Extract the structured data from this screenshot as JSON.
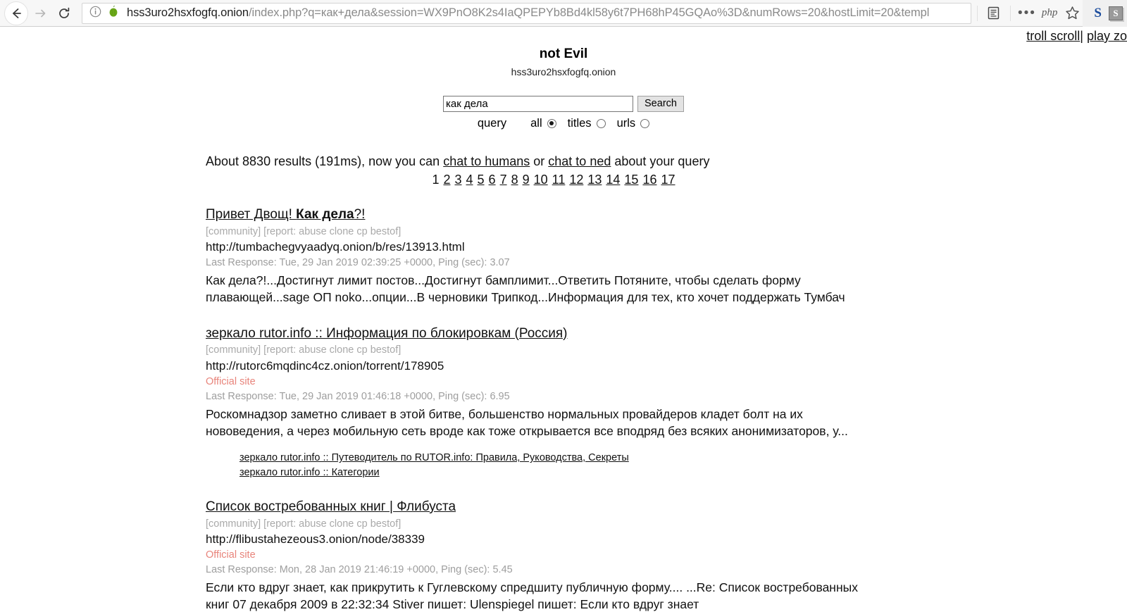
{
  "browser": {
    "url_host": "hss3uro2hsxfogfq.onion",
    "url_path": "/index.php?q=как+дела&session=WX9PnO8K2s4IaQPEPYb8Bd4kl58y6t7PH68hP45GQAo%3D&numRows=20&hostLimit=20&templ",
    "back_icon": "back-arrow-icon",
    "forward_icon": "forward-arrow-icon",
    "reload_icon": "reload-icon",
    "info_icon": "info-icon",
    "onion_icon": "onion-icon",
    "reader_icon": "reader-mode-icon",
    "menu_dots": "•••",
    "php_badge": "php",
    "star_icon": "bookmark-star-icon",
    "ext_s_blue": "S",
    "ext_s_gray": "S"
  },
  "top_links": {
    "troll_scroll": "troll scroll",
    "separator": "|",
    "play_zo": "play zo"
  },
  "site": {
    "title": "not Evil",
    "domain": "hss3uro2hsxfogfq.onion"
  },
  "search": {
    "value": "как дела",
    "button_label": "Search",
    "query_label": "query",
    "options": [
      {
        "label": "all",
        "checked": true
      },
      {
        "label": "titles",
        "checked": false
      },
      {
        "label": "urls",
        "checked": false
      }
    ]
  },
  "summary": {
    "prefix": "About 8830 results (191ms), now you can ",
    "link1": "chat to humans",
    "middle": " or ",
    "link2": "chat to ned",
    "suffix": " about your query",
    "result_count": 8830,
    "time_ms": 191
  },
  "pagination": {
    "current": "1",
    "pages": [
      "2",
      "3",
      "4",
      "5",
      "6",
      "7",
      "8",
      "9",
      "10",
      "11",
      "12",
      "13",
      "14",
      "15",
      "16",
      "17"
    ]
  },
  "results": [
    {
      "title_plain1": "Привет Двощ! ",
      "title_bold": "Как дела",
      "title_plain2": "?!",
      "tags": "[community] [report: abuse clone cp bestof]",
      "url": "http://tumbachegvyaadyq.onion/b/res/13913.html",
      "official": null,
      "meta": "Last Response: Tue, 29 Jan 2019 02:39:25 +0000, Ping (sec): 3.07",
      "snippet": "Как дела?!...Достигнут лимит постов...Достигнут бамплимит...Ответить Потяните, чтобы сделать форму плавающей...sage ОП noko...опции...В черновики Трипкод...Информация для тех, кто хочет поддержать Тумбач",
      "sublinks": []
    },
    {
      "title_plain1": "зеркало rutor.info :: Информация по блокировкам (Россия)",
      "title_bold": "",
      "title_plain2": "",
      "tags": "[community] [report: abuse clone cp bestof]",
      "url": "http://rutorc6mqdinc4cz.onion/torrent/178905",
      "official": "Official site",
      "meta": "Last Response: Tue, 29 Jan 2019 01:46:18 +0000, Ping (sec): 6.95",
      "snippet": "Роскомнадзор заметно сливает в этой битве, большенство нормальных провайдеров кладет болт на их нововедения, а через мобильную сеть вроде как тоже открывается все вподряд без всяких анонимизаторов, у...",
      "sublinks": [
        "зеркало rutor.info :: Путеводитель по RUTOR.info: Правила, Руководства, Секреты",
        "зеркало rutor.info :: Категории"
      ]
    },
    {
      "title_plain1": "Список востребованных книг | Флибуста",
      "title_bold": "",
      "title_plain2": "",
      "tags": "[community] [report: abuse clone cp bestof]",
      "url": "http://flibustahezeous3.onion/node/38339",
      "official": "Official site",
      "meta": "Last Response: Mon, 28 Jan 2019 21:46:19 +0000, Ping (sec): 5.45",
      "snippet": "Если кто вдруг знает, как прикрутить к Гуглевскому спредшиту публичную форму.... ...Re: Список востребованных книг  07 декабря 2009  в 22:32:34 Stiver пишет:   Ulenspiegel пишет:   Если кто вдруг знает",
      "sublinks": []
    }
  ],
  "colors": {
    "official_site": "#e8847b",
    "meta_gray": "#9e9e9e",
    "tag_gray": "#a9a9a9",
    "onion_green": "#6aa818",
    "ext_blue": "#1a4b9c"
  }
}
